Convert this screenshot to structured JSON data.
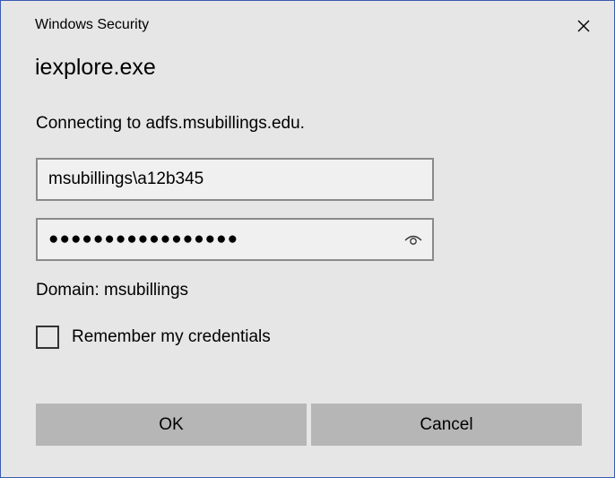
{
  "window": {
    "title": "Windows Security",
    "close_icon": "close-icon"
  },
  "app_name": "iexplore.exe",
  "message": "Connecting to adfs.msubillings.edu.",
  "username_field": {
    "value": "msubillings\\a12b345"
  },
  "password_field": {
    "value": "●●●●●●●●●●●●●●●●●",
    "reveal_icon": "eye-icon"
  },
  "domain_text": "Domain: msubillings",
  "remember": {
    "label": "Remember my credentials",
    "checked": false
  },
  "buttons": {
    "ok": "OK",
    "cancel": "Cancel"
  },
  "colors": {
    "dialog_bg": "#e6e6e6",
    "border": "#3a5bb0",
    "button_bg": "#b6b6b6",
    "field_bg": "#f0f0f0"
  }
}
